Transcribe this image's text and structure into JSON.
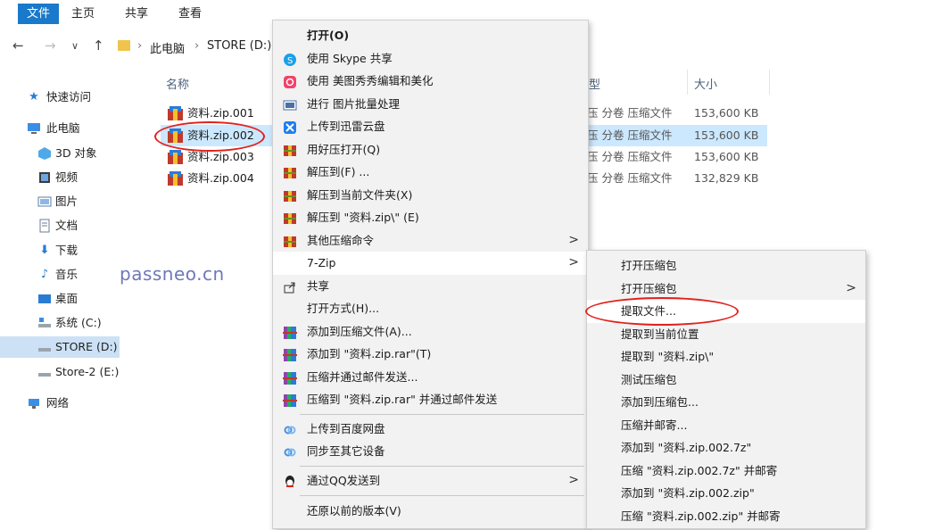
{
  "ribbon": {
    "tabs": [
      "文件",
      "主页",
      "共享",
      "查看"
    ]
  },
  "address": {
    "crumbs": [
      "此电脑",
      "STORE (D:)"
    ]
  },
  "sidebar": {
    "items": [
      {
        "label": "快速访问",
        "icon": "star-icon"
      },
      {
        "label": "此电脑",
        "icon": "computer-icon"
      },
      {
        "label": "3D 对象",
        "icon": "cube-icon"
      },
      {
        "label": "视频",
        "icon": "video-icon"
      },
      {
        "label": "图片",
        "icon": "picture-icon"
      },
      {
        "label": "文档",
        "icon": "document-icon"
      },
      {
        "label": "下载",
        "icon": "download-icon"
      },
      {
        "label": "音乐",
        "icon": "music-icon"
      },
      {
        "label": "桌面",
        "icon": "desktop-icon"
      },
      {
        "label": "系统 (C:)",
        "icon": "drive-icon"
      },
      {
        "label": "STORE (D:)",
        "icon": "drive-icon"
      },
      {
        "label": "Store-2 (E:)",
        "icon": "drive-icon"
      },
      {
        "label": "网络",
        "icon": "network-icon"
      }
    ]
  },
  "columns": {
    "name": "名称",
    "type": "型",
    "size": "大小"
  },
  "files": [
    {
      "name": "资料.zip.001",
      "type": "压 分卷 压缩文件",
      "size": "153,600 KB"
    },
    {
      "name": "资料.zip.002",
      "type": "压 分卷 压缩文件",
      "size": "153,600 KB"
    },
    {
      "name": "资料.zip.003",
      "type": "压 分卷 压缩文件",
      "size": "153,600 KB"
    },
    {
      "name": "资料.zip.004",
      "type": "压 分卷 压缩文件",
      "size": "132,829 KB"
    }
  ],
  "watermark": "passneo.cn",
  "context_menu": {
    "items": [
      {
        "label": "打开(O)",
        "icon": "",
        "bold": true
      },
      {
        "label": "使用 Skype 共享",
        "icon": "skype-icon"
      },
      {
        "label": "使用 美图秀秀编辑和美化",
        "icon": "meitu-icon"
      },
      {
        "label": "进行 图片批量处理",
        "icon": "batch-image-icon"
      },
      {
        "label": "上传到迅雷云盘",
        "icon": "xunlei-icon"
      },
      {
        "label": "用好压打开(Q)",
        "icon": "haozip-icon"
      },
      {
        "label": "解压到(F) ...",
        "icon": "haozip-icon"
      },
      {
        "label": "解压到当前文件夹(X)",
        "icon": "haozip-icon"
      },
      {
        "label": "解压到 \"资料.zip\\\" (E)",
        "icon": "haozip-icon"
      },
      {
        "label": "其他压缩命令",
        "icon": "haozip-icon",
        "submenu": true
      },
      {
        "label": "7-Zip",
        "icon": "",
        "submenu": true,
        "highlight": true
      },
      {
        "label": "共享",
        "icon": "share-icon"
      },
      {
        "label": "打开方式(H)...",
        "icon": ""
      },
      {
        "label": "添加到压缩文件(A)...",
        "icon": "winrar-icon"
      },
      {
        "label": "添加到 \"资料.zip.rar\"(T)",
        "icon": "winrar-icon"
      },
      {
        "label": "压缩并通过邮件发送...",
        "icon": "winrar-icon"
      },
      {
        "label": "压缩到 \"资料.zip.rar\" 并通过邮件发送",
        "icon": "winrar-icon"
      },
      {
        "label": "上传到百度网盘",
        "icon": "baidu-icon"
      },
      {
        "label": "同步至其它设备",
        "icon": "baidu-icon"
      },
      {
        "label": "通过QQ发送到",
        "icon": "qq-icon",
        "submenu": true
      },
      {
        "label": "还原以前的版本(V)",
        "icon": ""
      }
    ]
  },
  "submenu_7zip": {
    "items": [
      {
        "label": "打开压缩包"
      },
      {
        "label": "打开压缩包",
        "submenu": true
      },
      {
        "label": "提取文件...",
        "highlight": true
      },
      {
        "label": "提取到当前位置"
      },
      {
        "label": "提取到 \"资料.zip\\\""
      },
      {
        "label": "测试压缩包"
      },
      {
        "label": "添加到压缩包..."
      },
      {
        "label": "压缩并邮寄..."
      },
      {
        "label": "添加到 \"资料.zip.002.7z\""
      },
      {
        "label": "压缩 \"资料.zip.002.7z\" 并邮寄"
      },
      {
        "label": "添加到 \"资料.zip.002.zip\""
      },
      {
        "label": "压缩 \"资料.zip.002.zip\" 并邮寄"
      }
    ]
  }
}
